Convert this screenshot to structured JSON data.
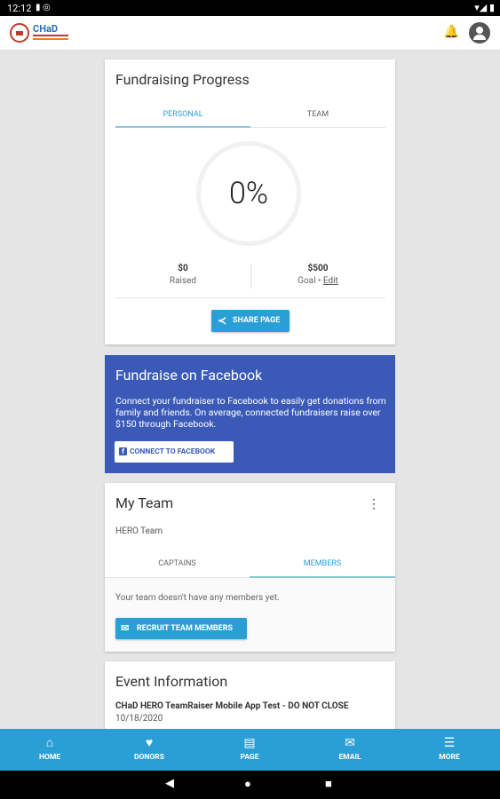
{
  "status_bar": {
    "time": "12:12",
    "left_icons": "▮ ◎",
    "right_icons": "▾◢ ▮"
  },
  "app_bar": {
    "logo_text": "CHaD",
    "notification_icon": "bell-icon",
    "profile_icon": "account-circle-icon"
  },
  "fundraising": {
    "title": "Fundraising Progress",
    "tabs": [
      {
        "label": "PERSONAL",
        "active": true
      },
      {
        "label": "TEAM",
        "active": false
      }
    ],
    "percent": "0%",
    "raised": {
      "amount": "$0",
      "label": "Raised"
    },
    "goal": {
      "amount": "$500",
      "label": "Goal •",
      "edit_label": "Edit"
    },
    "share_button": "SHARE PAGE"
  },
  "facebook": {
    "title": "Fundraise on Facebook",
    "description": "Connect your fundraiser to Facebook to easily get donations from family and friends. On average, connected fundraisers raise over $150 through Facebook.",
    "button": "CONNECT TO FACEBOOK"
  },
  "team": {
    "title": "My Team",
    "name": "HERO Team",
    "tabs": [
      {
        "label": "CAPTAINS",
        "active": false
      },
      {
        "label": "MEMBERS",
        "active": true
      }
    ],
    "empty_message": "Your team doesn't have any members yet.",
    "recruit_button": "RECRUIT TEAM MEMBERS"
  },
  "event": {
    "title": "Event Information",
    "name": "CHaD HERO TeamRaiser Mobile App Test - DO NOT CLOSE",
    "date": "10/18/2020"
  },
  "bottom_nav": [
    {
      "label": "HOME",
      "icon": "home-icon"
    },
    {
      "label": "DONORS",
      "icon": "heart-icon"
    },
    {
      "label": "PAGE",
      "icon": "page-icon"
    },
    {
      "label": "EMAIL",
      "icon": "email-icon"
    },
    {
      "label": "MORE",
      "icon": "menu-icon"
    }
  ],
  "colors": {
    "accent": "#2a9fd6",
    "facebook": "#3b5ab8",
    "background": "#e5e5e5"
  }
}
